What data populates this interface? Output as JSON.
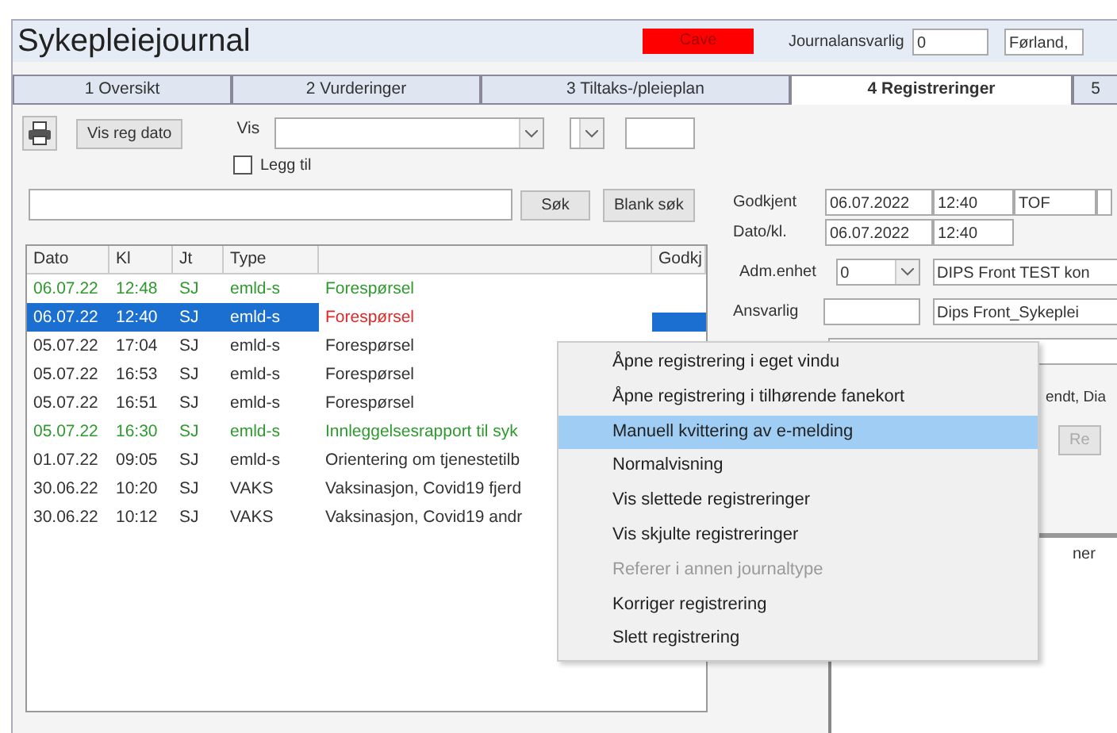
{
  "window": {
    "title": "Sykepleiejournal"
  },
  "header": {
    "alert": "Cave",
    "journal_label": "Journalansvarlig",
    "journal_fields": [
      "0",
      "Førland,"
    ]
  },
  "tabs": [
    {
      "label": "1 Oversikt",
      "selected": false
    },
    {
      "label": "2 Vurderinger",
      "selected": false
    },
    {
      "label": "3 Tiltaks-/pleieplan",
      "selected": false
    },
    {
      "label": "4 Registreringer",
      "selected": true
    },
    {
      "label": "5",
      "selected": false
    }
  ],
  "toolbar": {
    "date_button": "Vis reg dato",
    "vis_label": "Vis",
    "legg_til": {
      "label": "Legg til",
      "checked": false
    }
  },
  "search": {
    "search_button": "Søk",
    "clear_button": "Blank søk"
  },
  "table": {
    "columns": [
      "Dato",
      "Kl",
      "Jt",
      "Type",
      "Godkj"
    ],
    "rows": [
      {
        "date": "06.07.22",
        "time": "12:48",
        "jt": "SJ",
        "type": "emld-s",
        "description": "Forespørsel",
        "color": "#2e9a2e",
        "selected": false
      },
      {
        "date": "06.07.22",
        "time": "12:40",
        "jt": "SJ",
        "type": "emld-s",
        "description": "Forespørsel",
        "color": "#e02828",
        "selected": true
      },
      {
        "date": "05.07.22",
        "time": "17:04",
        "jt": "SJ",
        "type": "emld-s",
        "description": "Forespørsel",
        "color": "#333333",
        "selected": false
      },
      {
        "date": "05.07.22",
        "time": "16:53",
        "jt": "SJ",
        "type": "emld-s",
        "description": "Forespørsel",
        "color": "#333333",
        "selected": false
      },
      {
        "date": "05.07.22",
        "time": "16:51",
        "jt": "SJ",
        "type": "emld-s",
        "description": "Forespørsel",
        "color": "#333333",
        "selected": false
      },
      {
        "date": "05.07.22",
        "time": "16:30",
        "jt": "SJ",
        "type": "emld-s",
        "description": "Innleggelsesrapport til syk",
        "color": "#2e9a2e",
        "selected": false
      },
      {
        "date": "01.07.22",
        "time": "09:05",
        "jt": "SJ",
        "type": "emld-s",
        "description": "Orientering om tjenestetilb",
        "color": "#333333",
        "selected": false
      },
      {
        "date": "30.06.22",
        "time": "10:20",
        "jt": "SJ",
        "type": "VAKS",
        "description": "Vaksinasjon, Covid19 fjerd",
        "color": "#333333",
        "selected": false
      },
      {
        "date": "30.06.22",
        "time": "10:12",
        "jt": "SJ",
        "type": "VAKS",
        "description": "Vaksinasjon, Covid19 andr",
        "color": "#333333",
        "selected": false
      }
    ]
  },
  "details": {
    "approved": {
      "label": "Godkjent",
      "values": [
        "06.07.2022",
        "12:40",
        "TOF"
      ]
    },
    "datetime": {
      "label": "Dato/kl.",
      "values": [
        "06.07.2022",
        "12:40"
      ]
    },
    "unit": {
      "label": "Adm.enhet",
      "code": "0",
      "name": "DIPS Front TEST kon"
    },
    "responsible": {
      "label": "Ansvarlig",
      "name": "Dips Front_Sykeplei"
    },
    "partial_text": "endt, Dia",
    "partial_button": "Re",
    "partial_label": "ner"
  },
  "context_menu": {
    "items": [
      {
        "label": "Åpne registrering i eget vindu",
        "selected": false,
        "disabled": false
      },
      {
        "label": "Åpne registrering i tilhørende fanekort",
        "selected": false,
        "disabled": false
      },
      {
        "label": "Manuell kvittering av e-melding",
        "selected": true,
        "disabled": false
      },
      {
        "label": "Normalvisning",
        "selected": false,
        "disabled": false
      },
      {
        "label": "Vis slettede registreringer",
        "selected": false,
        "disabled": false
      },
      {
        "label": "Vis skjulte registreringer",
        "selected": false,
        "disabled": false
      },
      {
        "label": "Referer i annen journaltype",
        "selected": false,
        "disabled": true
      },
      {
        "label": "Korriger registrering",
        "selected": false,
        "disabled": false
      },
      {
        "label": "Slett registrering",
        "selected": false,
        "disabled": false
      }
    ]
  }
}
